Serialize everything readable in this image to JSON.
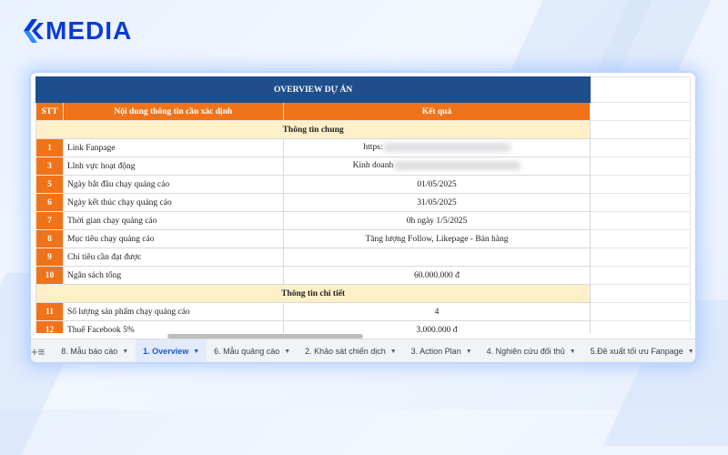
{
  "brand": {
    "name": "MEDIA",
    "color": "#0a3bd8"
  },
  "sheet": {
    "title": "OVERVIEW DỰ ÁN",
    "headers": {
      "stt": "STT",
      "content": "Nội dung thông tin cần xác định",
      "result": "Kết quả"
    },
    "sections": [
      {
        "heading": "Thông tin chung",
        "rows": [
          {
            "stt": "1",
            "content": "Link Fanpage",
            "result": "https:"
          },
          {
            "stt": "3",
            "content": "Lĩnh vực hoạt động",
            "result": "Kinh doanh"
          },
          {
            "stt": "5",
            "content": "Ngày bắt đầu chạy quảng cáo",
            "result": "01/05/2025"
          },
          {
            "stt": "6",
            "content": "Ngày kết thúc chạy quảng cáo",
            "result": "31/05/2025"
          },
          {
            "stt": "7",
            "content": "Thời gian chạy quảng cáo",
            "result": "0h ngày 1/5/2025"
          },
          {
            "stt": "8",
            "content": "Mục tiêu chạy quảng cáo",
            "result": "Tăng lượng Follow, Likepage - Bán hàng"
          },
          {
            "stt": "9",
            "content": "Chỉ tiêu cần đạt được",
            "result": ""
          },
          {
            "stt": "10",
            "content": "Ngân sách tổng",
            "result": "60.000.000 đ"
          }
        ]
      },
      {
        "heading": "Thông tin chi tiết",
        "rows": [
          {
            "stt": "11",
            "content": "Số lượng sản phẩm chạy quảng cáo",
            "result": "4"
          },
          {
            "stt": "12",
            "content": "Thuế Facebook 5%",
            "result": "3.000.000 đ"
          }
        ]
      }
    ]
  },
  "tabbar": {
    "add_icon": "plus-icon",
    "menu_icon": "hamburger-icon",
    "tabs": [
      {
        "label": "8. Mẫu báo cáo",
        "active": false
      },
      {
        "label": "1. Overview",
        "active": true
      },
      {
        "label": "6. Mẫu quảng cáo",
        "active": false
      },
      {
        "label": "2. Khảo sát chiến dịch",
        "active": false
      },
      {
        "label": "3. Action Plan",
        "active": false
      },
      {
        "label": "4. Nghiên cứu đối thủ",
        "active": false
      },
      {
        "label": "5.Đề xuất tối ưu Fanpage",
        "active": false
      }
    ]
  },
  "colors": {
    "title_bg": "#1f4e8c",
    "header_orange": "#f0731a",
    "section_bg": "#fdf0c9",
    "active_tab": "#1a56c8"
  }
}
